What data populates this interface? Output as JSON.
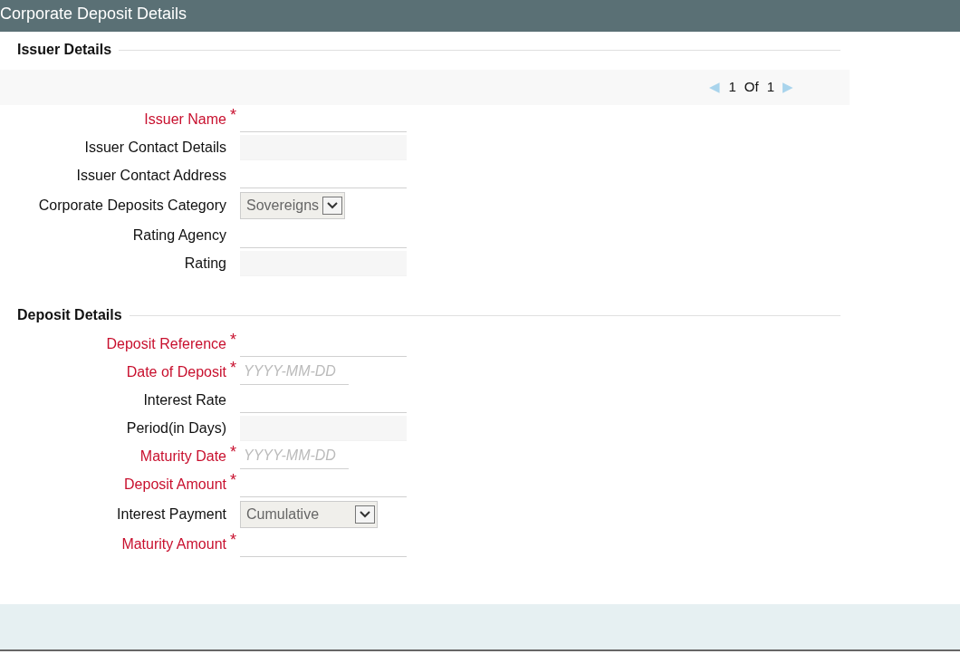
{
  "window": {
    "title": "Corporate Deposit Details"
  },
  "sections": [
    {
      "heading": "Issuer Details",
      "pager": {
        "prev": "◀",
        "current": "1",
        "of": "Of",
        "total": "1",
        "next": "▶"
      },
      "fields": [
        {
          "label": "Issuer Name",
          "kind": "text",
          "required": true,
          "required_mark": "*"
        },
        {
          "label": "Issuer Contact Details",
          "kind": "readonly",
          "required": false
        },
        {
          "label": "Issuer Contact Address",
          "kind": "text",
          "required": false
        },
        {
          "label": "Corporate Deposits Category",
          "kind": "select",
          "required": false,
          "value": "Sovereigns"
        },
        {
          "label": "Rating Agency",
          "kind": "text",
          "required": false
        },
        {
          "label": "Rating",
          "kind": "readonly",
          "required": false
        }
      ]
    },
    {
      "heading": "Deposit Details",
      "fields": [
        {
          "label": "Deposit Reference",
          "kind": "text",
          "required": true,
          "required_mark": "*"
        },
        {
          "label": "Date of Deposit",
          "kind": "date",
          "required": true,
          "required_mark": "*",
          "placeholder": "YYYY-MM-DD"
        },
        {
          "label": "Interest Rate",
          "kind": "text",
          "required": false
        },
        {
          "label": "Period(in Days)",
          "kind": "readonly",
          "required": false
        },
        {
          "label": "Maturity Date",
          "kind": "date",
          "required": true,
          "required_mark": "*",
          "placeholder": "YYYY-MM-DD"
        },
        {
          "label": "Deposit Amount",
          "kind": "text",
          "required": true,
          "required_mark": "*"
        },
        {
          "label": "Interest Payment",
          "kind": "select",
          "required": false,
          "value": "Cumulative",
          "wide": true
        },
        {
          "label": "Maturity Amount",
          "kind": "text",
          "required": true,
          "required_mark": "*"
        }
      ]
    }
  ]
}
